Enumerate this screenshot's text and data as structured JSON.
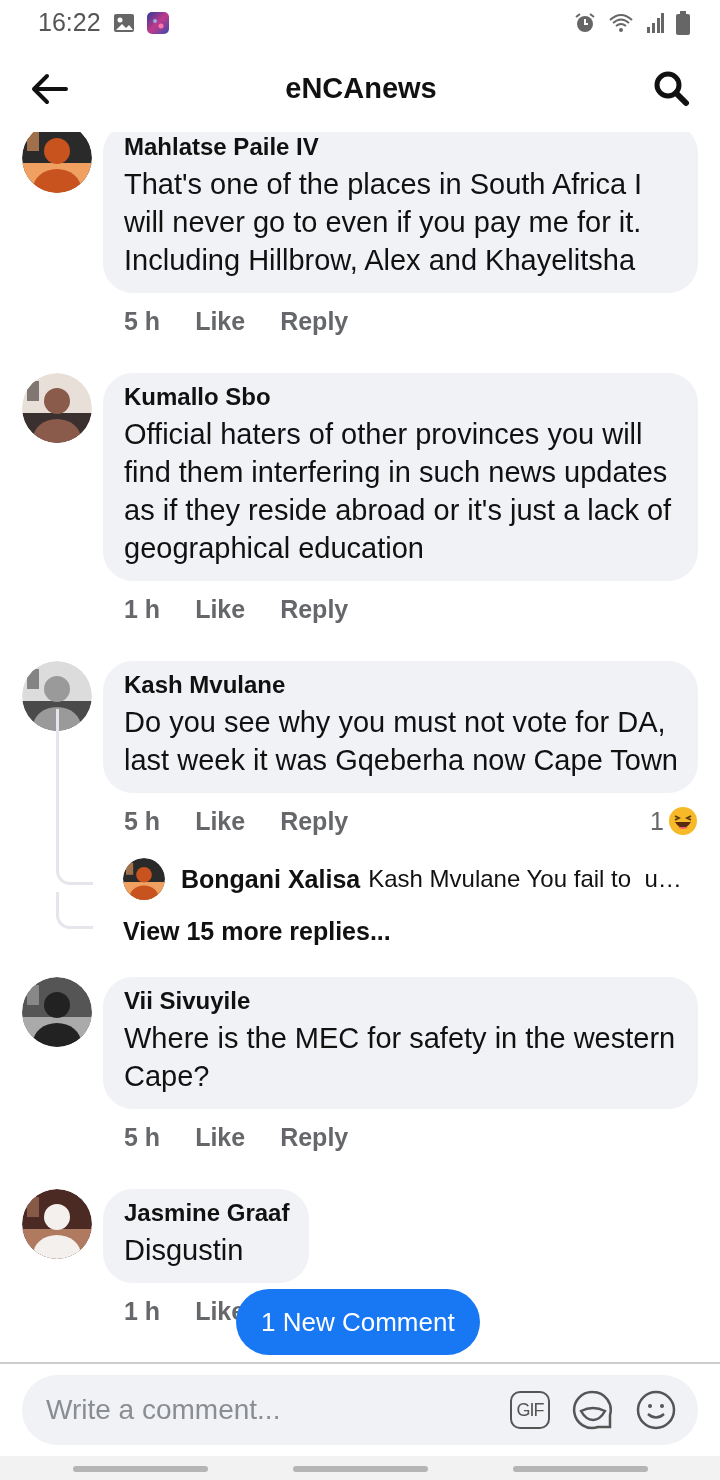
{
  "status_bar": {
    "time": "16:22"
  },
  "header": {
    "title": "eNCAnews"
  },
  "comments": [
    {
      "author": "Mahlatse Paile IV",
      "text": "That's one of the places in South Africa I will never go to even if you pay me for it. Including Hillbrow, Alex and Khayelitsha",
      "time": "5 h",
      "actions": [
        "Like",
        "Reply"
      ]
    },
    {
      "author": "Kumallo Sbo",
      "text": "Official haters of other provinces you will find them interfering in such news updates as if they reside abroad or it's just a lack of geographical education",
      "time": "1 h",
      "actions": [
        "Like",
        "Reply"
      ]
    },
    {
      "author": "Kash Mvulane",
      "text": "Do you see why you must not vote for DA, last week it was Gqeberha now Cape Town",
      "time": "5 h",
      "actions": [
        "Like",
        "Reply"
      ],
      "reaction_count": "1",
      "replies": [
        {
          "author": "Bongani Xalisa",
          "text": "Kash Mvulane You fail to  u…"
        }
      ],
      "more_replies": "View 15 more replies..."
    },
    {
      "author": "Vii Sivuyile",
      "text": "Where is the MEC for safety in the western Cape?",
      "time": "5 h",
      "actions": [
        "Like",
        "Reply"
      ]
    },
    {
      "author": "Jasmine Graaf",
      "text": "Disgustin",
      "time": "1 h",
      "actions": [
        "Like"
      ]
    }
  ],
  "new_comment_button": {
    "label": "1 New Comment"
  },
  "composer": {
    "placeholder": "Write a comment...",
    "gif": "GIF"
  }
}
